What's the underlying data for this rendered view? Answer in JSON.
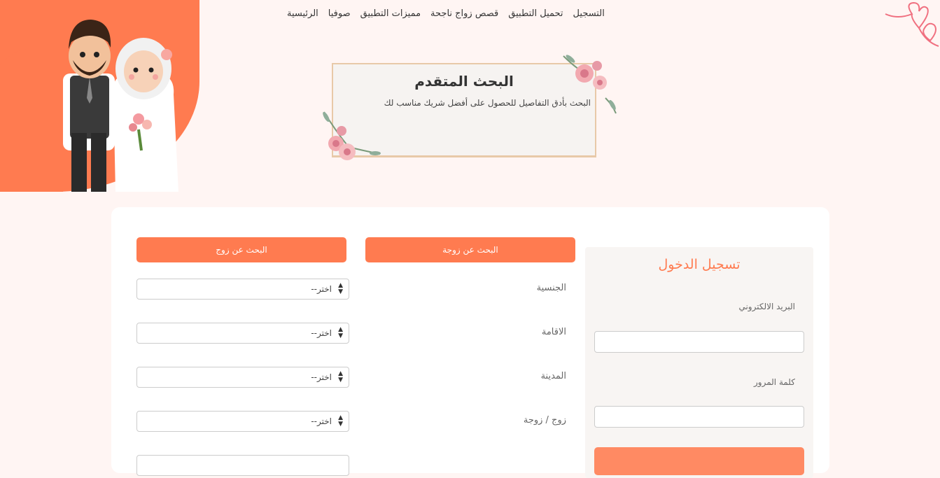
{
  "nav": {
    "items": [
      "الرئيسية",
      "صوفيا",
      "مميزات التطبيق",
      "قصص زواج ناجحة",
      "تحميل التطبيق",
      "التسجيل"
    ]
  },
  "hero": {
    "title": "البحث المتقدم",
    "subtitle": "البحث بأدق التفاصيل للحصول على أفضل شريك مناسب لك"
  },
  "search": {
    "wife_button": "البحث عن زوجة",
    "husband_button": "البحث عن زوج",
    "fields": [
      {
        "label": "الجنسية",
        "value": "اختر--"
      },
      {
        "label": "الاقامة",
        "value": "اختر--"
      },
      {
        "label": "المدينة",
        "value": "اختر--"
      },
      {
        "label": "زوج / زوجة",
        "value": "اختر--"
      }
    ]
  },
  "login": {
    "title": "تسجيل الدخول",
    "email_label": "البريد الالكتروني",
    "password_label": "كلمة المرور"
  },
  "colors": {
    "accent": "#ff7b50",
    "background": "#fff5f3"
  }
}
